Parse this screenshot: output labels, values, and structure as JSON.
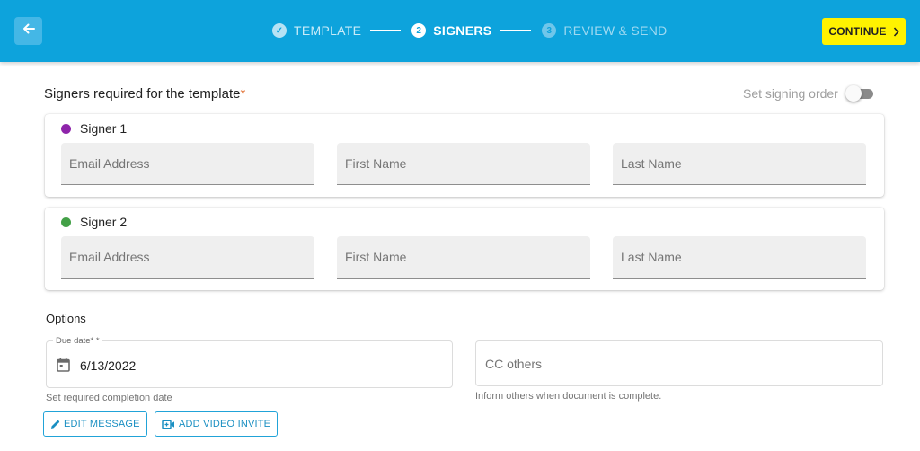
{
  "header": {
    "back_icon": "arrow-left-icon",
    "steps": [
      {
        "number": "✓",
        "label": "TEMPLATE",
        "state": "done"
      },
      {
        "number": "2",
        "label": "SIGNERS",
        "state": "active"
      },
      {
        "number": "3",
        "label": "REVIEW & SEND",
        "state": "pending"
      }
    ],
    "continue_label": "CONTINUE",
    "colors": {
      "bar": "#0da3dc",
      "continue": "#fff200"
    }
  },
  "signers_section": {
    "title": "Signers required for the template",
    "required_mark": "*",
    "signing_order_label": "Set signing order",
    "signing_order_on": false
  },
  "signers": [
    {
      "label": "Signer 1",
      "color": "#8e24aa",
      "email_placeholder": "Email Address",
      "first_name_placeholder": "First Name",
      "last_name_placeholder": "Last Name"
    },
    {
      "label": "Signer 2",
      "color": "#43a047",
      "email_placeholder": "Email Address",
      "first_name_placeholder": "First Name",
      "last_name_placeholder": "Last Name"
    }
  ],
  "options": {
    "title": "Options",
    "due_date_label": "Due date* *",
    "due_date_value": "6/13/2022",
    "due_date_help": "Set required completion date",
    "cc_placeholder": "CC others",
    "cc_help": "Inform others when document is complete.",
    "edit_message_label": "EDIT MESSAGE",
    "add_video_label": "ADD VIDEO INVITE"
  }
}
